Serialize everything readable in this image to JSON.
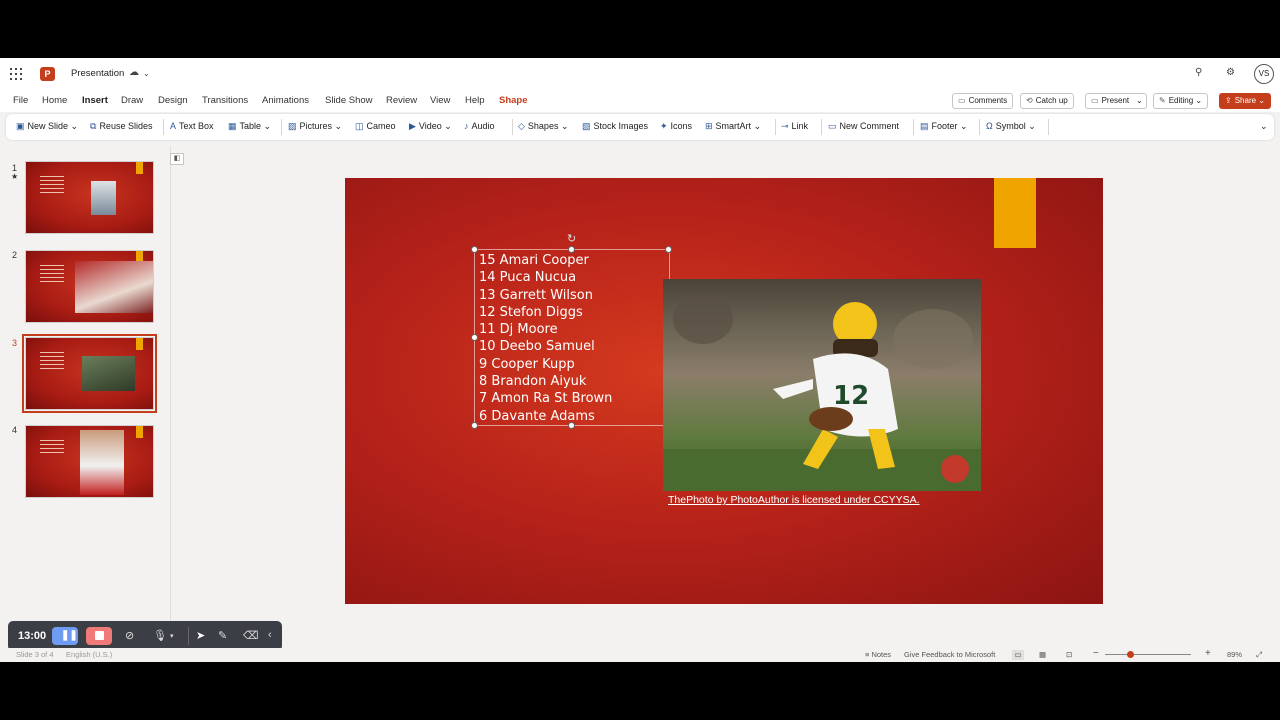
{
  "app": {
    "doc_title": "Presentation",
    "avatar_initials": "VS"
  },
  "menu": {
    "tabs": [
      "File",
      "Home",
      "Insert",
      "Draw",
      "Design",
      "Transitions",
      "Animations",
      "Slide Show",
      "Review",
      "View",
      "Help",
      "Shape"
    ],
    "active_tab": "Insert",
    "comments": "Comments",
    "catch_up": "Catch up",
    "present": "Present",
    "editing": "Editing",
    "share": "Share"
  },
  "ribbon": {
    "new_slide": "New Slide",
    "reuse_slides": "Reuse Slides",
    "text_box": "Text Box",
    "table": "Table",
    "pictures": "Pictures",
    "cameo": "Cameo",
    "video": "Video",
    "audio": "Audio",
    "shapes": "Shapes",
    "stock_images": "Stock Images",
    "icons": "Icons",
    "smartart": "SmartArt",
    "link": "Link",
    "new_comment": "New Comment",
    "footer": "Footer",
    "symbol": "Symbol"
  },
  "thumbnails": {
    "numbers": [
      "1",
      "2",
      "3",
      "4"
    ],
    "selected": "3"
  },
  "slide": {
    "players": [
      "15 Amari Cooper",
      "14 Puca Nucua",
      "13 Garrett Wilson",
      "12 Stefon Diggs",
      "11 Dj Moore",
      "10 Deebo Samuel",
      "9 Cooper Kupp",
      "8 Brandon Aiyuk",
      "7 Amon Ra St Brown",
      "6 Davante Adams"
    ],
    "photo_credit": "ThePhoto by PhotoAuthor is licensed under CCYYSA."
  },
  "recorder": {
    "time": "13:00"
  },
  "status": {
    "slide_info": "Slide 3 of 4",
    "language": "English (U.S.)",
    "notes": "Notes",
    "feedback": "Give Feedback to Microsoft",
    "zoom": "89%"
  },
  "colors": {
    "accent": "#c43e1c",
    "slide_red": "#b8231a",
    "slide_bar": "#f0a400"
  }
}
